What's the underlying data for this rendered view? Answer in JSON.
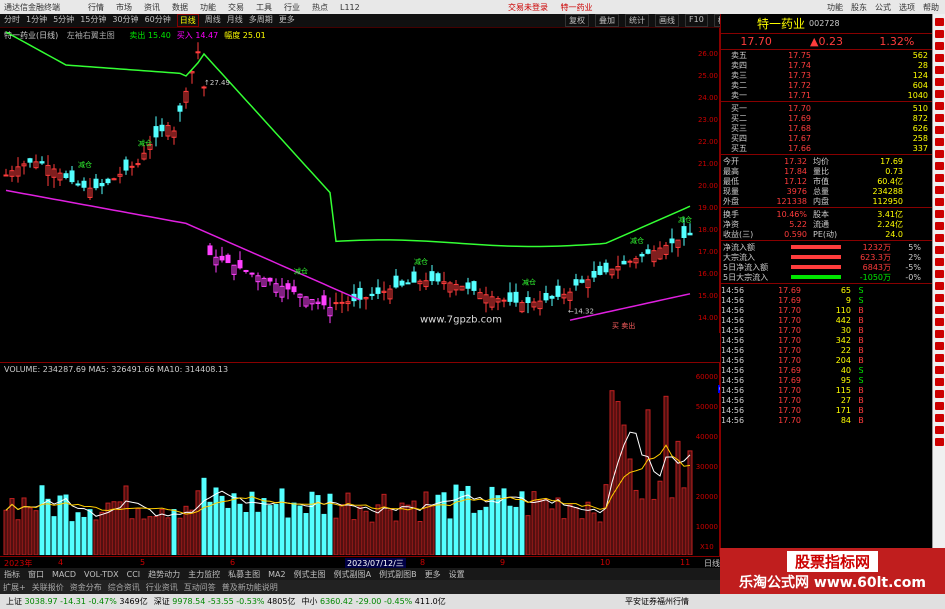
{
  "window": {
    "app_title": "通达信金融终端",
    "menu": [
      "行情",
      "市场",
      "资讯",
      "数据",
      "功能",
      "交易",
      "工具",
      "行业",
      "热点",
      "L112"
    ],
    "center": [
      "交易未登录",
      "特一药业"
    ],
    "right": [
      "功能",
      "股东",
      "公式",
      "选项",
      "帮助"
    ]
  },
  "toolbar": {
    "timeframes": [
      "分时",
      "1分钟",
      "5分钟",
      "15分钟",
      "30分钟",
      "60分钟",
      "日线",
      "周线",
      "月线",
      "多周期",
      "更多"
    ],
    "active_timeframe": "日线",
    "tools": [
      "复权",
      "叠加",
      "统计",
      "画线",
      "F10",
      "标记",
      "+自选"
    ]
  },
  "main_chart": {
    "stock_label": "特一药业(日线)",
    "indicator_name": "左袖右翼主图",
    "ind_values": [
      {
        "text": "卖出 15.40",
        "color": "#00e600"
      },
      {
        "text": "买入 14.47",
        "color": "#f0f"
      },
      {
        "text": "幅度 25.01",
        "color": "#ff0"
      }
    ],
    "signal_label": "减仓",
    "price_axis": [
      "26.00",
      "25.00",
      "24.00",
      "23.00",
      "22.00",
      "21.00",
      "20.00",
      "19.00",
      "18.00",
      "17.00",
      "16.00",
      "15.00",
      "14.00"
    ],
    "annotations": [
      {
        "text": "↑27.49",
        "kind": "high"
      },
      {
        "text": "←14.32",
        "kind": "low"
      }
    ],
    "url_watermark": "www.7gpzb.com",
    "bottom_tags": [
      "买",
      "卖出"
    ]
  },
  "vol_chart": {
    "label": "VOLUME: 234287.69  MA5: 326491.66  MA10: 314408.13",
    "axis": [
      "60000",
      "50000",
      "40000",
      "30000",
      "20000",
      "10000"
    ],
    "unit": "X10",
    "marker": "61578"
  },
  "time_axis": {
    "labels": [
      "2023年",
      "4",
      "5",
      "6",
      "2023/07/12/三",
      "8",
      "9",
      "10",
      "11"
    ],
    "right": "日线"
  },
  "indicator_tabs": [
    "指标",
    "窗口",
    "MACD",
    "VOL-TDX",
    "CCI",
    "趋势动力",
    "主力监控",
    "私募主图",
    "MA2",
    "例式主图",
    "例式副图A",
    "例式副图B",
    "更多",
    "设置"
  ],
  "bottom_tabs": [
    "扩展+",
    "关联报价",
    "资金分布",
    "综合资讯",
    "行业资讯",
    "互动问答",
    "普及新功能说明"
  ],
  "status": [
    {
      "name": "上证",
      "value": "3038.97",
      "chg": "-14.31",
      "pct": "-0.47%",
      "amt": "3469亿",
      "dir": "dn"
    },
    {
      "name": "深证",
      "value": "9978.54",
      "chg": "-53.55",
      "pct": "-0.53%",
      "amt": "4805亿",
      "dir": "dn"
    },
    {
      "name": "中小",
      "value": "6360.42",
      "chg": "-29.00",
      "pct": "-0.45%",
      "amt": "411.0亿",
      "dir": "dn"
    }
  ],
  "status_right": "平安证券福州行情",
  "side": {
    "name": "特一药业",
    "code": "002728",
    "price": "17.70",
    "change": "▲0.23",
    "pct": "1.32%",
    "asks": [
      {
        "label": "卖五",
        "price": "17.75",
        "vol": "562"
      },
      {
        "label": "卖四",
        "price": "17.74",
        "vol": "28"
      },
      {
        "label": "卖三",
        "price": "17.73",
        "vol": "124"
      },
      {
        "label": "卖二",
        "price": "17.72",
        "vol": "604"
      },
      {
        "label": "卖一",
        "price": "17.71",
        "vol": "1040"
      }
    ],
    "bids": [
      {
        "label": "买一",
        "price": "17.70",
        "vol": "510"
      },
      {
        "label": "买二",
        "price": "17.69",
        "vol": "872"
      },
      {
        "label": "买三",
        "price": "17.68",
        "vol": "626"
      },
      {
        "label": "买四",
        "price": "17.67",
        "vol": "258"
      },
      {
        "label": "买五",
        "price": "17.66",
        "vol": "337"
      }
    ],
    "stats": [
      [
        "今开",
        "17.32",
        "均价",
        "17.69"
      ],
      [
        "最高",
        "17.84",
        "量比",
        "0.73"
      ],
      [
        "最低",
        "17.12",
        "市值",
        "60.4亿"
      ],
      [
        "现量",
        "3976",
        "总量",
        "234288"
      ],
      [
        "外盘",
        "121338",
        "内盘",
        "112950"
      ]
    ],
    "stats2": [
      [
        "换手",
        "10.46%",
        "股本",
        "3.41亿"
      ],
      [
        "净资",
        "5.22",
        "流通",
        "2.24亿"
      ],
      [
        "收益(三)",
        "0.590",
        "PE(动)",
        "24.0"
      ]
    ],
    "flows": [
      {
        "label": "净流入额",
        "value": "1232万",
        "pct": "5%"
      },
      {
        "label": "大宗流入",
        "value": "623.3万",
        "pct": "2%"
      },
      {
        "label": "5日净流入额",
        "value": "6843万",
        "pct": "-5%"
      },
      {
        "label": "5日大宗流入",
        "value": "-1050万",
        "pct": "-0%"
      }
    ],
    "ticks": [
      [
        "14:56",
        "17.69",
        "65",
        "S"
      ],
      [
        "14:56",
        "17.69",
        "9",
        "S"
      ],
      [
        "14:56",
        "17.70",
        "110",
        "B"
      ],
      [
        "14:56",
        "17.70",
        "442",
        "B"
      ],
      [
        "14:56",
        "17.70",
        "30",
        "B"
      ],
      [
        "14:56",
        "17.70",
        "342",
        "B"
      ],
      [
        "14:56",
        "17.70",
        "22",
        "B"
      ],
      [
        "14:56",
        "17.70",
        "204",
        "B"
      ],
      [
        "14:56",
        "17.69",
        "40",
        "S"
      ],
      [
        "14:56",
        "17.69",
        "95",
        "S"
      ],
      [
        "14:56",
        "17.70",
        "115",
        "B"
      ],
      [
        "14:56",
        "17.70",
        "27",
        "B"
      ],
      [
        "14:56",
        "17.70",
        "171",
        "B"
      ],
      [
        "14:56",
        "17.70",
        "84",
        "B"
      ]
    ]
  },
  "watermark": {
    "line1": "股票指标网",
    "line2": "乐淘公式网 www.60lt.com"
  }
}
